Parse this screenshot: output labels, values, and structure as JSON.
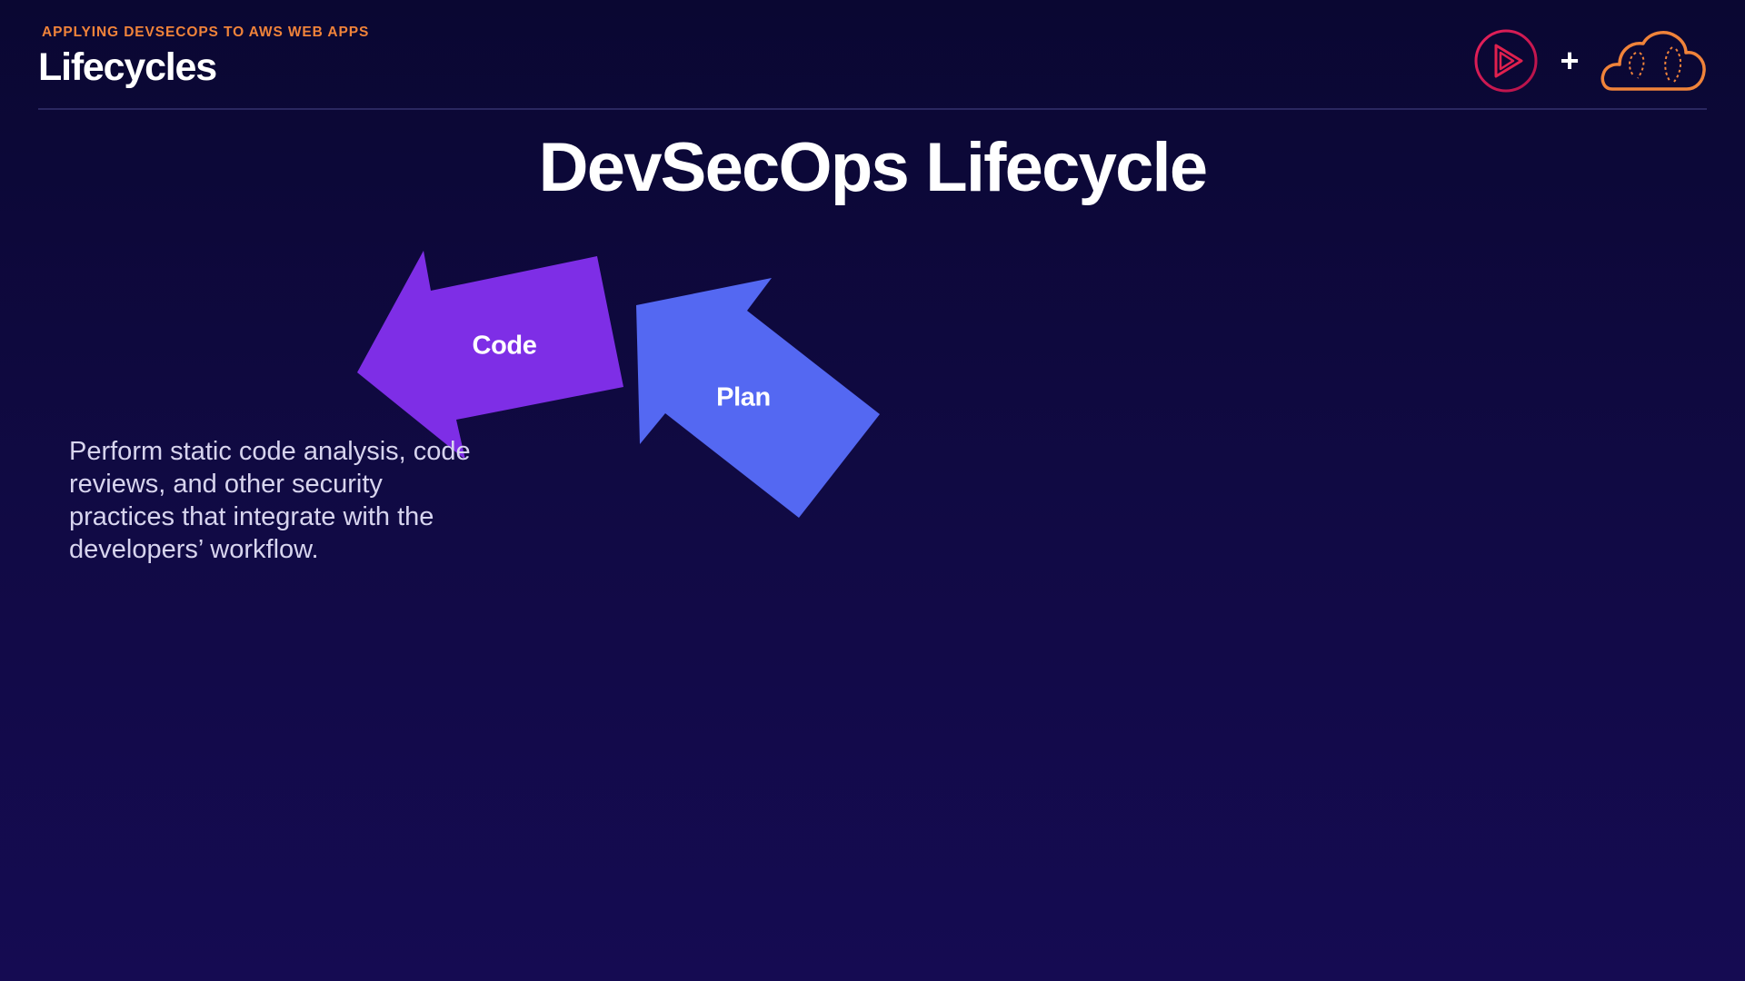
{
  "header": {
    "kicker": "APPLYING DEVSECOPS TO AWS WEB APPS",
    "section_title": "Lifecycles",
    "plus_symbol": "+"
  },
  "slide": {
    "title": "DevSecOps Lifecycle",
    "stages": [
      {
        "label": "Code",
        "color": "#7e2ee6"
      },
      {
        "label": "Plan",
        "color": "#5468f2"
      }
    ],
    "description": "Perform static code analysis, code reviews, and other security practices that integrate with the developers’ workflow."
  },
  "colors": {
    "accent": "#f0833a",
    "logo_play": "#e0204e",
    "background_top": "#0a0732",
    "background_bottom": "#150b52"
  },
  "icons": [
    "pluralsight-play-logo-icon",
    "cloud-logo-icon"
  ]
}
